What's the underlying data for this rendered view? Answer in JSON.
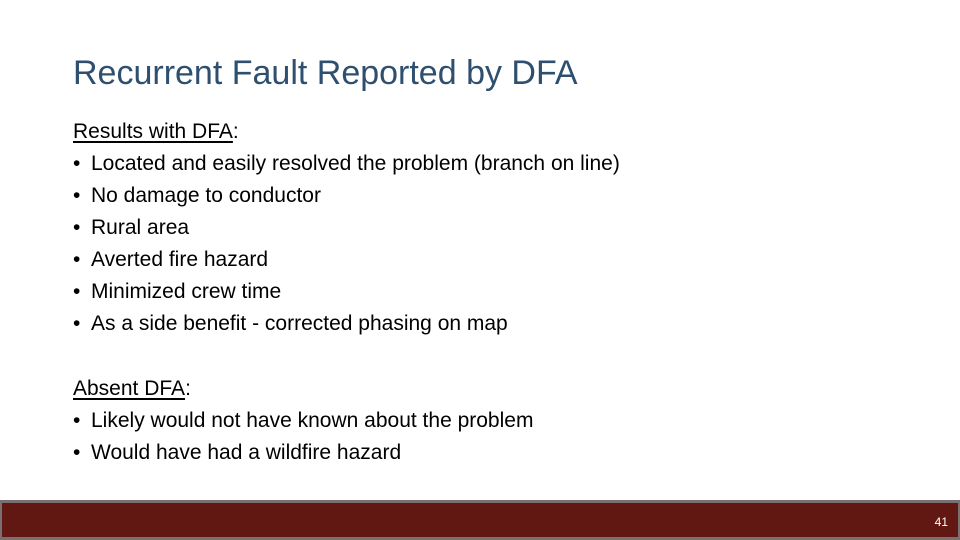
{
  "slide": {
    "title": "Recurrent Fault Reported by DFA",
    "sections": [
      {
        "heading": "Results with DFA",
        "heading_suffix": ":",
        "bullets": [
          "Located and easily resolved the problem (branch on line)",
          "No damage to conductor",
          "Rural area",
          "Averted fire hazard",
          "Minimized crew time",
          "As a side benefit - corrected phasing on map"
        ]
      },
      {
        "heading": "Absent DFA",
        "heading_suffix": ":",
        "bullets": [
          "Likely would not have known about the problem",
          "Would have had a wildfire hazard"
        ]
      }
    ],
    "bullet_glyph": "•",
    "page_number": "41"
  },
  "colors": {
    "title": "#2f4f6f",
    "footer_bar": "#621812",
    "footer_border": "#7a7070"
  }
}
